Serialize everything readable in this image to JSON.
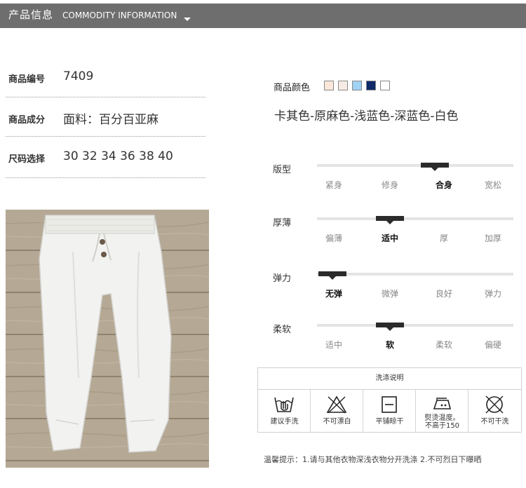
{
  "header": {
    "title_cn": "产品信息",
    "title_en": "COMMODITY INFORMATION"
  },
  "info": [
    {
      "label": "商品编号",
      "value": "7409"
    },
    {
      "label": "商品成分",
      "value": "面料：百分百亚麻"
    },
    {
      "label": "尺码选择",
      "value": "30 32 34 36 38 40"
    }
  ],
  "colors": {
    "label": "商品颜色",
    "swatches": [
      "#fbe7da",
      "#f6ebe4",
      "#9fd2f3",
      "#102a6a",
      "#ffffff"
    ],
    "text": "卡其色-原麻色-浅蓝色-深蓝色-白色"
  },
  "ratings": [
    {
      "label": "版型",
      "options": [
        "紧身",
        "修身",
        "合身",
        "宽松"
      ],
      "selected_index": 2,
      "level": 0.6
    },
    {
      "label": "厚薄",
      "options": [
        "偏薄",
        "适中",
        "厚",
        "加厚"
      ],
      "selected_index": 1,
      "level": 0.37
    },
    {
      "label": "弹力",
      "options": [
        "无弹",
        "微弹",
        "良好",
        "弹力"
      ],
      "selected_index": 0,
      "level": 0.08
    },
    {
      "label": "柔软",
      "options": [
        "适中",
        "软",
        "柔软",
        "偏硬"
      ],
      "selected_index": 1,
      "level": 0.37
    }
  ],
  "wash": {
    "title": "洗涤说明",
    "items": [
      {
        "icon": "hand-wash-icon",
        "lines": [
          "建议手洗"
        ]
      },
      {
        "icon": "no-bleach-icon",
        "lines": [
          "不可漂白"
        ]
      },
      {
        "icon": "flat-dry-icon",
        "lines": [
          "平铺晾干"
        ]
      },
      {
        "icon": "iron-temperature-icon",
        "lines": [
          "熨烫温度。",
          "不高于150"
        ]
      },
      {
        "icon": "no-dry-clean-icon",
        "lines": [
          "不可干洗"
        ]
      }
    ]
  },
  "tip": "温馨提示：1.请与其他衣物深浅衣物分开洗涤  2.不可烈日下曝晒",
  "photo": {
    "subject": "white linen drawstring trousers on wooden floor"
  }
}
